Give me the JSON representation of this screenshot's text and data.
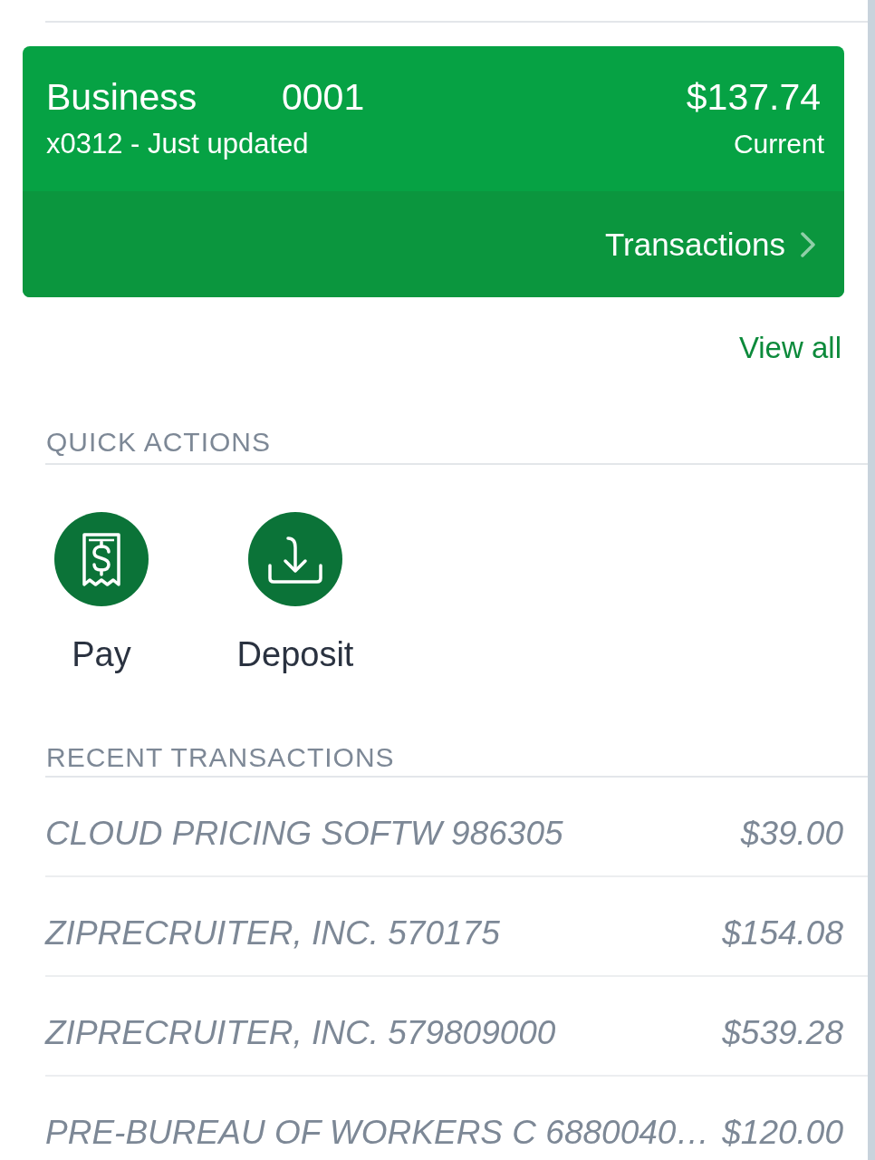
{
  "account_card": {
    "name": "Business",
    "number": "0001",
    "subtitle": "x0312 - Just updated",
    "balance": "$137.74",
    "balance_label": "Current",
    "link": "Transactions"
  },
  "view_all": "View all",
  "quick_actions": {
    "heading": "QUICK ACTIONS",
    "items": [
      {
        "kind": "pay",
        "label": "Pay"
      },
      {
        "kind": "deposit",
        "label": "Deposit"
      }
    ]
  },
  "recent_transactions": {
    "heading": "RECENT TRANSACTIONS",
    "rows": [
      {
        "description": "CLOUD PRICING SOFTW 986305",
        "amount": "$39.00"
      },
      {
        "description": "ZIPRECRUITER, INC. 570175",
        "amount": "$154.08"
      },
      {
        "description": "ZIPRECRUITER, INC. 579809000",
        "amount": "$539.28"
      },
      {
        "description": "PRE-BUREAU OF WORKERS C 6880040…",
        "amount": "$120.00"
      }
    ]
  }
}
